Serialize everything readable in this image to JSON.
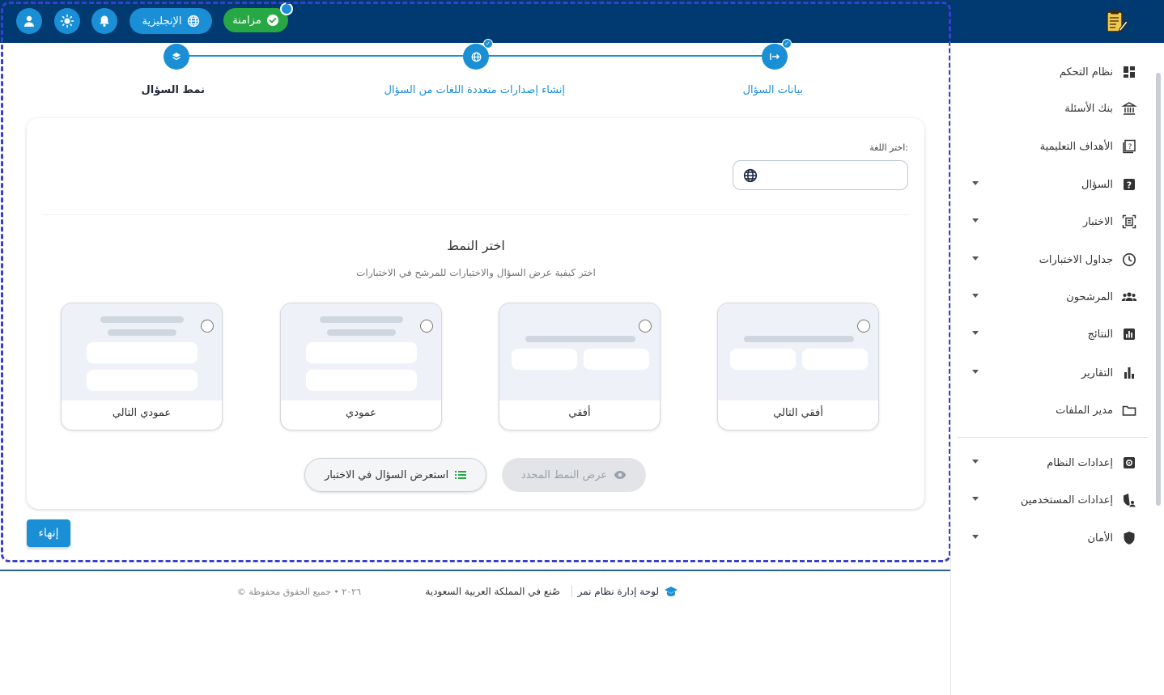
{
  "header": {
    "sync_label": "مزامنة",
    "language_label": "الإنجليزية",
    "icons": [
      "user-icon",
      "theme-sun-icon",
      "bell-icon",
      "globe-icon",
      "check-circle-icon",
      "clipboard-logo-icon"
    ]
  },
  "stepper": {
    "steps": [
      {
        "label": "بيانات السؤال",
        "state": "completed",
        "icon": "arrows-icon"
      },
      {
        "label": "إنشاء إصدارات متعددة اللغات من السؤال",
        "state": "completed",
        "icon": "globe-icon"
      },
      {
        "label": "نمط السؤال",
        "state": "active",
        "icon": "layers-icon"
      }
    ]
  },
  "form": {
    "language_label": "اختر اللغة:",
    "language_value": "",
    "pattern_title": "اختر النمط",
    "pattern_subtitle": "اختر كيفية عرض السؤال والاختيارات للمرشح في الاختبارات",
    "patterns": [
      {
        "name": "أفقي التالي",
        "selected": false
      },
      {
        "name": "أفقي",
        "selected": false
      },
      {
        "name": "عمودي",
        "selected": false
      },
      {
        "name": "عمودي التالي",
        "selected": false
      }
    ],
    "view_selected_label": "عرض النمط المحدد",
    "preview_label": "استعرض السؤال في الاختبار",
    "finish_label": "إنهاء"
  },
  "footer": {
    "brand": "لوحة إدارة نظام نمر",
    "made_in": "صُنع في المملكة العربية السعودية",
    "copyright": "© ٢٠٢٦ • جميع الحقوق محفوظة"
  },
  "sidebar": {
    "items": [
      {
        "label": "نظام التحكم",
        "icon": "dashboard-icon",
        "has_submenu": false
      },
      {
        "label": "بنك الأسئلة",
        "icon": "bank-icon",
        "has_submenu": false
      },
      {
        "label": "الأهداف التعليمية",
        "icon": "book-question-icon",
        "has_submenu": false
      },
      {
        "label": "السؤال",
        "icon": "question-box-icon",
        "has_submenu": true
      },
      {
        "label": "الاختبار",
        "icon": "exam-frame-icon",
        "has_submenu": true
      },
      {
        "label": "جداول الاختبارات",
        "icon": "clock-icon",
        "has_submenu": true
      },
      {
        "label": "المرشحون",
        "icon": "people-icon",
        "has_submenu": true
      },
      {
        "label": "النتائج",
        "icon": "results-chart-icon",
        "has_submenu": true
      },
      {
        "label": "التقارير",
        "icon": "bar-chart-icon",
        "has_submenu": true
      },
      {
        "label": "مدير الملفات",
        "icon": "folder-icon",
        "has_submenu": false
      },
      {
        "label": "إعدادات النظام",
        "icon": "settings-box-icon",
        "has_submenu": true
      },
      {
        "label": "إعدادات المستخدمين",
        "icon": "user-shield-icon",
        "has_submenu": true
      },
      {
        "label": "الأمان",
        "icon": "shield-icon",
        "has_submenu": true
      }
    ]
  },
  "colors": {
    "header_bg": "#003a70",
    "primary": "#1a8fd6",
    "success": "#27a844",
    "focus_frame": "#3b3fd1"
  }
}
